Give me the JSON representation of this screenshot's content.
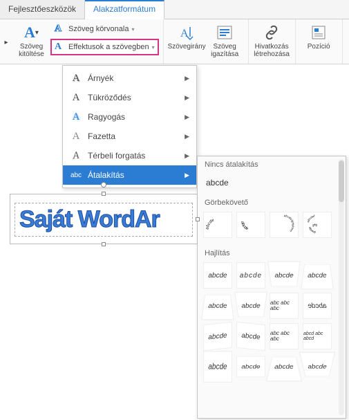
{
  "tabs": {
    "dev": "Fejlesztőeszközök",
    "shapefmt": "Alakzatformátum"
  },
  "ribbon": {
    "textfill_label": "Szöveg\nkitöltése",
    "outline_label": "Szöveg körvonala",
    "effects_label": "Effektusok a szövegben",
    "direction_label": "Szövegirány",
    "align_label": "Szöveg\nigazítása",
    "link_label": "Hivatkozás\nlétrehozása",
    "position_label": "Pozíció"
  },
  "effects_menu": {
    "items": [
      {
        "label": "Árnyék",
        "icon": "shadow"
      },
      {
        "label": "Tükröződés",
        "icon": "reflect"
      },
      {
        "label": "Ragyogás",
        "icon": "glow"
      },
      {
        "label": "Fazetta",
        "icon": "bevel"
      },
      {
        "label": "Térbeli forgatás",
        "icon": "rotate3d"
      },
      {
        "label": "Átalakítás",
        "icon": "transform",
        "selected": true
      }
    ]
  },
  "transform_panel": {
    "section_none": "Nincs átalakítás",
    "none_sample": "abcde",
    "section_follow": "Görbekövető",
    "follow_items": [
      "abcde",
      "abcdefghijklmn",
      "abcde",
      "abcdef ghij klmnop"
    ],
    "section_warp": "Hajlítás",
    "warp_sample": "abcde",
    "warp_alt1": "abc abc abc",
    "warp_alt2": "abcd abc abcd"
  },
  "wordart_text": "Saját WordAr"
}
